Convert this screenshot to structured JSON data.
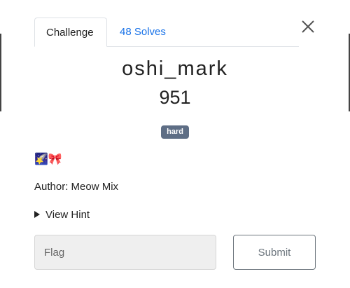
{
  "tabs": {
    "challenge_label": "Challenge",
    "solves_label": "48 Solves"
  },
  "challenge": {
    "name": "oshi_mark",
    "points": "951",
    "difficulty": "hard",
    "description_emoji": "🌠🎀",
    "author": "Author: Meow Mix",
    "hint_label": "View Hint"
  },
  "form": {
    "flag_placeholder": "Flag",
    "submit_label": "Submit"
  },
  "colors": {
    "accent_link": "#1a73e8",
    "badge_bg": "#5e6e85",
    "input_bg": "#efefef",
    "button_border": "#6c757d"
  },
  "icons": {
    "close": "close-icon",
    "hint": "triangle-right-icon"
  }
}
